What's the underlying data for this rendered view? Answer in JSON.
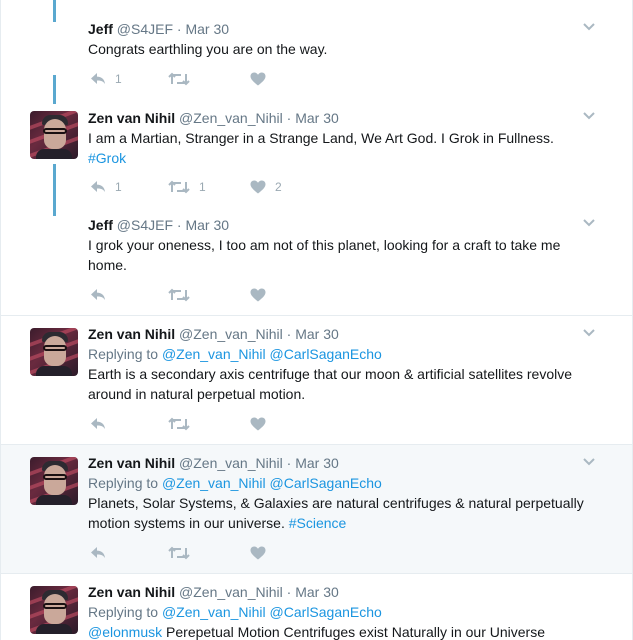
{
  "tweets": [
    {
      "name": "Jeff",
      "handle": "@S4JEF",
      "dot": "·",
      "date": "Mar 30",
      "text": "Congrats earthling you are on the way.",
      "reply_count": "1",
      "retweet_count": "",
      "like_count": ""
    },
    {
      "name": "Zen van Nihil",
      "handle": "@Zen_van_Nihil",
      "dot": "·",
      "date": "Mar 30",
      "text": "I am a Martian, Stranger in a Strange Land, We Art God. I Grok in Fullness.",
      "hashtag": "#Grok",
      "reply_count": "1",
      "retweet_count": "1",
      "like_count": "2"
    },
    {
      "name": "Jeff",
      "handle": "@S4JEF",
      "dot": "·",
      "date": "Mar 30",
      "text": "I grok your oneness, I too am not of this planet, looking for a craft to take me home.",
      "reply_count": "",
      "retweet_count": "",
      "like_count": ""
    },
    {
      "name": "Zen van Nihil",
      "handle": "@Zen_van_Nihil",
      "dot": "·",
      "date": "Mar 30",
      "replying_to": "Replying to",
      "mention1": "@Zen_van_Nihil",
      "mention2": "@CarlSaganEcho",
      "text": "Earth is a secondary axis centrifuge that our moon & artificial satellites revolve around in natural perpetual motion.",
      "reply_count": "",
      "retweet_count": "",
      "like_count": ""
    },
    {
      "name": "Zen van Nihil",
      "handle": "@Zen_van_Nihil",
      "dot": "·",
      "date": "Mar 30",
      "replying_to": "Replying to",
      "mention1": "@Zen_van_Nihil",
      "mention2": "@CarlSaganEcho",
      "text": "Planets, Solar Systems, & Galaxies are natural centrifuges & natural perpetually motion systems in our universe.",
      "hashtag": "#Science",
      "reply_count": "",
      "retweet_count": "",
      "like_count": ""
    },
    {
      "name": "Zen van Nihil",
      "handle": "@Zen_van_Nihil",
      "dot": "·",
      "date": "Mar 30",
      "replying_to": "Replying to",
      "mention1": "@Zen_van_Nihil",
      "mention2": "@CarlSaganEcho",
      "mention3": "@elonmusk",
      "text": " Perepetual Motion Centrifuges exist Naturally in our Universe"
    }
  ],
  "icons": {
    "reply": "reply-icon",
    "retweet": "retweet-icon",
    "like": "heart-icon",
    "caret": "chevron-down-icon",
    "color": "#aab8c2",
    "link_color": "#1b95e0",
    "thread_color": "#5aa8cf"
  }
}
